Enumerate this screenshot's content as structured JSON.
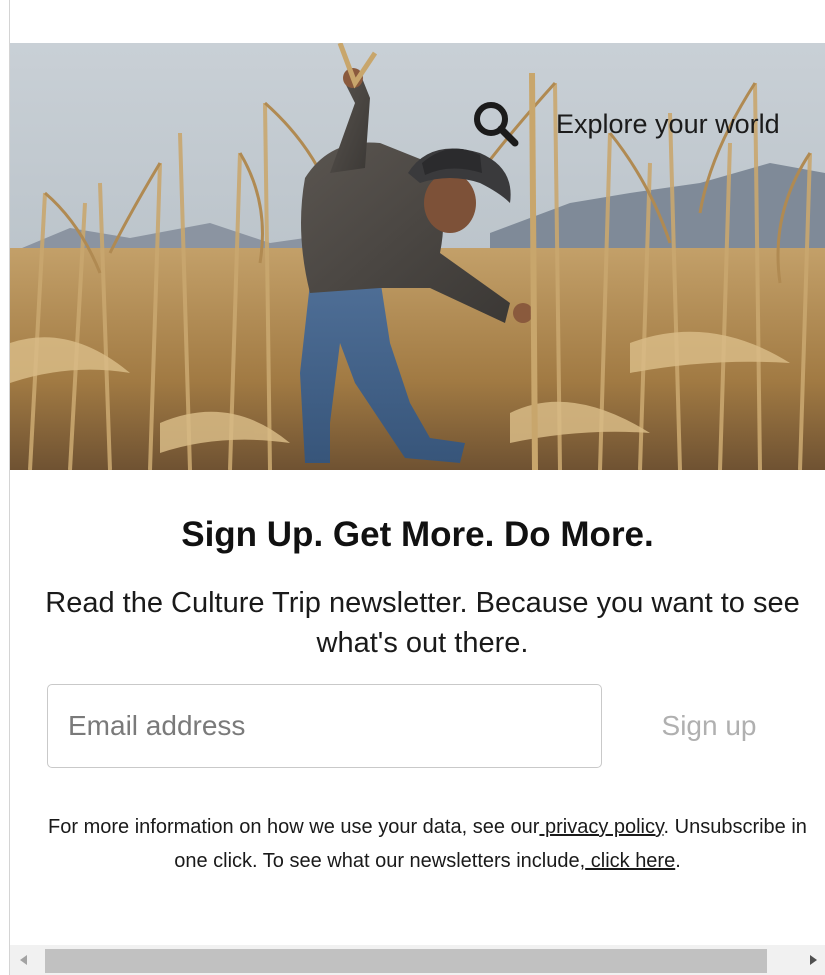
{
  "hero": {
    "search_icon": "search-icon",
    "search_label": "Explore your world",
    "image_subject": "farmer cutting dried corn stalks"
  },
  "signup": {
    "headline": "Sign Up. Get More. Do More.",
    "subtitle": "Read the Culture Trip newsletter. Because you want to see what's out there.",
    "email_placeholder": "Email address",
    "email_value": "",
    "button_label": "Sign up"
  },
  "disclaimer": {
    "part1": "For more information on how we use your data, see our",
    "privacy_link": " privacy policy",
    "part2": ". Unsubscribe in one click. To see what our newsletters include,",
    "click_here_link": " click here",
    "part3": "."
  },
  "colors": {
    "sky": "#b9c2c9",
    "field": "#a9844c",
    "button_text": "#b0b0b0"
  }
}
